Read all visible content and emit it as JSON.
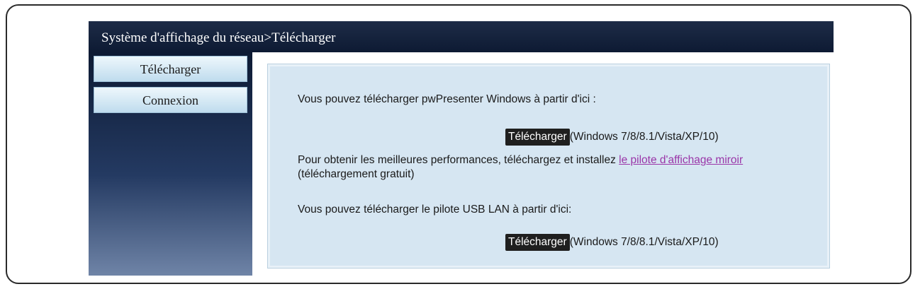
{
  "header": {
    "title": "Système d'affichage du réseau>Télécharger"
  },
  "sidebar": {
    "items": [
      {
        "label": "Télécharger"
      },
      {
        "label": "Connexion"
      }
    ]
  },
  "content": {
    "intro_windows": "Vous pouvez télécharger pwPresenter Windows à partir d'ici :",
    "download_label": "Télécharger",
    "os_note": "(Windows 7/8/8.1/Vista/XP/10)",
    "perf_text_before": "Pour obtenir les meilleures performances, téléchargez et installez ",
    "mirror_driver_link": "le pilote d'affichage miroir",
    "perf_text_after": " (téléchargement gratuit)",
    "intro_usb": "Vous pouvez télécharger le pilote USB LAN à partir d'ici:",
    "download_label_2": "Télécharger",
    "os_note_2": "(Windows 7/8/8.1/Vista/XP/10)"
  },
  "colors": {
    "title_bar": "#0d1a33",
    "panel_bg": "#d6e6f2",
    "link": "#9a35a8",
    "button_bg": "#1f1f1f"
  }
}
